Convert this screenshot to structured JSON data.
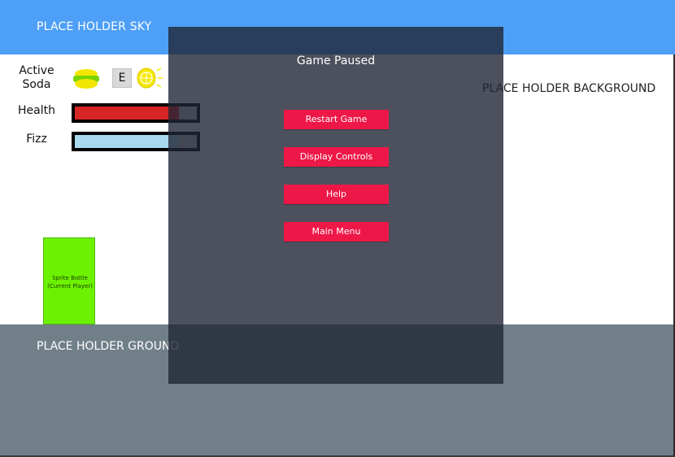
{
  "world": {
    "sky_label": "PLACE HOLDER SKY",
    "background_label": "PLACE HOLDER BACKGROUND",
    "ground_label": "PLACE HOLDER GROUND",
    "sky_color": "#4d9ff7",
    "ground_color": "#707f88"
  },
  "player": {
    "label": "Sprite Bottle (Current Player)",
    "color": "#6cf200"
  },
  "hud": {
    "active_soda_label": "Active Soda",
    "active_soda_icon": "lemon-lime-soda-icon",
    "swap_key": "E",
    "next_soda_icon": "lemon-icon",
    "health_label": "Health",
    "health_fraction": 0.85,
    "health_color": "#d62525",
    "fizz_label": "Fizz",
    "fizz_fraction": 0.85,
    "fizz_color": "#a8d8ec"
  },
  "pause_menu": {
    "title": "Game Paused",
    "buttons": {
      "restart": "Restart Game",
      "controls": "Display Controls",
      "help": "Help",
      "main_menu": "Main Menu"
    },
    "button_color": "#ee1848"
  }
}
